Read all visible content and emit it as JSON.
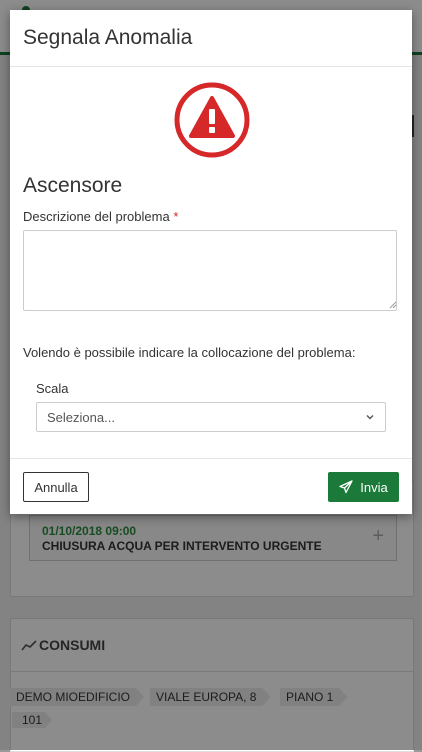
{
  "modal": {
    "title": "Segnala Anomalia",
    "subject": "Ascensore",
    "description_label": "Descrizione del problema",
    "required_marker": "*",
    "description_value": "",
    "location_hint": "Volendo è possibile indicare la collocazione del problema:",
    "scala_label": "Scala",
    "scala_value": "Seleziona...",
    "cancel_label": "Annulla",
    "send_label": "Invia",
    "icons": {
      "warning": "warning-triangle-icon",
      "send": "paper-plane-icon",
      "select": "chevron-down-icon"
    }
  },
  "background": {
    "notice_date": "01/10/2018 09:00",
    "notice_title": "CHIUSURA ACQUA PER INTERVENTO URGENTE",
    "section_title": "CONSUMI",
    "breadcrumbs": [
      "DEMO MIOEDIFICIO",
      "VIALE EUROPA, 8",
      "PIANO 1",
      "101"
    ]
  },
  "colors": {
    "brand_green": "#1b7a3a",
    "warning_red": "#d62828"
  }
}
